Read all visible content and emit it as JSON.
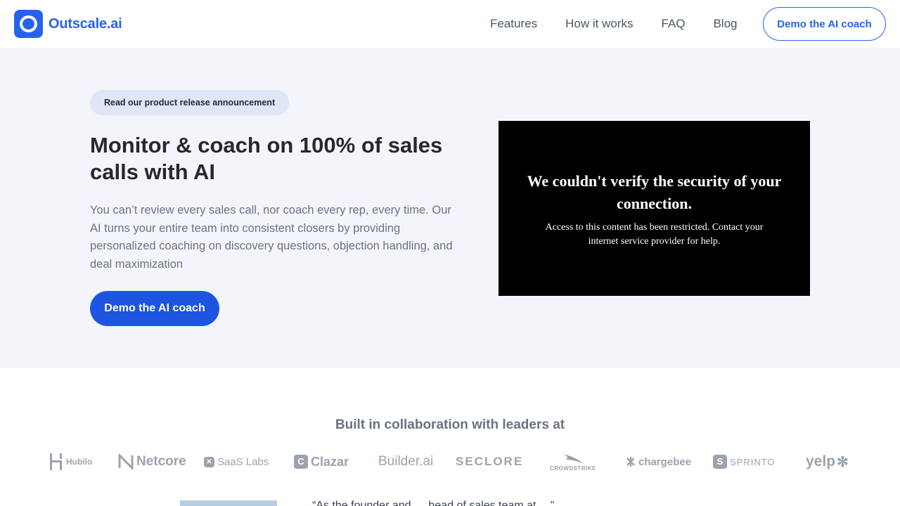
{
  "nav": {
    "logo_text": "Outscale.ai",
    "links": [
      {
        "label": "Features"
      },
      {
        "label": "How it works"
      },
      {
        "label": "FAQ"
      },
      {
        "label": "Blog"
      }
    ],
    "cta_label": "Demo the AI coach"
  },
  "hero": {
    "announcement": "Read our product release announcement",
    "title": "Monitor & coach on 100% of sales calls with AI",
    "description": "You can’t review every sales call, nor coach every rep, every time. Our AI turns your entire team into consistent closers by providing personalized coaching on discovery questions, objection handling, and deal maximization",
    "cta_label": "Demo the AI coach"
  },
  "video": {
    "heading": "We couldn't verify the security of your connection.",
    "subtext": "Access to this content has been restricted. Contact your internet service provider for help."
  },
  "collaboration": {
    "title": "Built in collaboration with leaders at",
    "brands": [
      {
        "name": "Hubilo"
      },
      {
        "name": "Netcore"
      },
      {
        "name": "SaaS Labs"
      },
      {
        "name": "Clazar"
      },
      {
        "name": "Builder.ai"
      },
      {
        "name": "SECLORE"
      },
      {
        "name": "CROWDSTRIKE"
      },
      {
        "name": "chargebee"
      },
      {
        "name": "SPRINTO"
      },
      {
        "name": "yelp"
      }
    ]
  },
  "testimonial": {
    "quote_fragment": "“As the founder and … head of sales team at …”"
  },
  "colors": {
    "brand_blue": "#2563eb",
    "hero_background": "#f3f5fb",
    "text_muted": "#6b7280"
  }
}
